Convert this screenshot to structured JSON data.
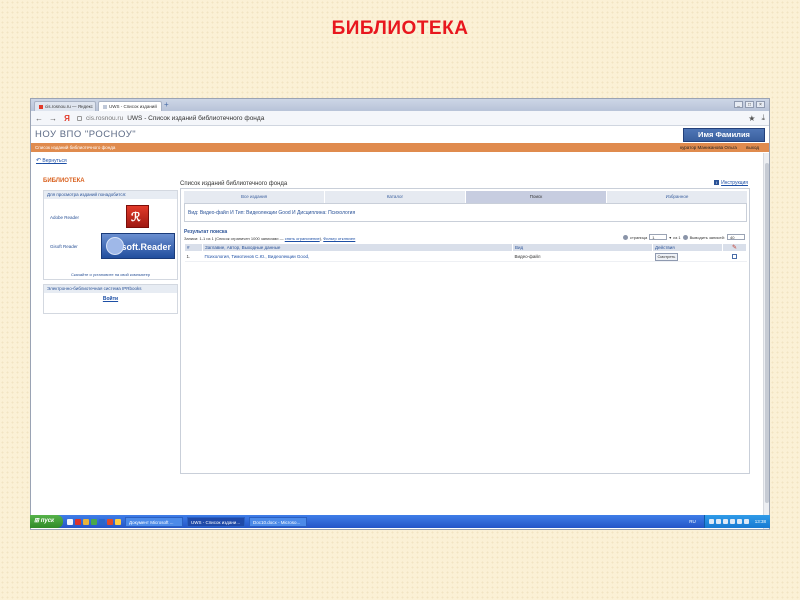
{
  "slide": {
    "title": "БИБЛИОТЕКА"
  },
  "browser": {
    "tabs": [
      {
        "label": "cis.rosnou.ru — Яндекс",
        "active": false
      },
      {
        "label": "UWS - Список изданий",
        "active": true
      }
    ],
    "url_domain": "cis.rosnou.ru",
    "url_title": "UWS - Список изданий библиотечного фонда"
  },
  "header": {
    "logo": "НОУ ВПО \"РОСНОУ\"",
    "user_name": "Имя Фамилия",
    "breadcrumb": "Список изданий библиотечного фонда",
    "user_role": "куратор Маниканова Ольга",
    "logout": "выход"
  },
  "back_link": "Вернуться",
  "sidebar": {
    "heading": "БИБЛИОТЕКА",
    "readers_panel": {
      "title": "Для просмотра изданий понадобится:",
      "adobe_label": "Adobe Reader",
      "gisoft_label": "Gisoft Reader",
      "gisoft_logo_text": "Gisoft.Reader",
      "download_note": "Скачайте и установите на свой компьютер"
    },
    "ebs_panel": {
      "title": "Электронно-библиотечная система IPRbooks",
      "login": "Войти"
    }
  },
  "main": {
    "title": "Список изданий библиотечного фонда",
    "instruction": "Инструкция",
    "tabs": [
      {
        "label": "Все издания",
        "active": false
      },
      {
        "label": "Каталог",
        "active": false
      },
      {
        "label": "Поиск",
        "active": true
      },
      {
        "label": "Избранное",
        "active": false
      }
    ],
    "search_criteria": "Вид: Видео-файл И Тип: Видеолекции Good И Дисциплина: Психология",
    "results_title": "Результат поиска",
    "records_prefix": "Записи: 1-1 из 1 (Список ограничен 1000 записями — ",
    "records_link1": "снять ограничение",
    "records_sep": "), ",
    "records_link2": "Фильтр отключен",
    "pager": {
      "page_label": "страница",
      "page_value": "1",
      "of_label": "из 1",
      "per_page_label": "Выводить записей:",
      "per_page_value": "40"
    },
    "table": {
      "columns": [
        "#",
        "Заглавие, Автор, Выходные данные",
        "Вид",
        "Действия"
      ],
      "rows": [
        {
          "num": "1.",
          "title": "Психология, Тимотинов С.Ю., Видеолекции Good,",
          "kind": "Видео-файл",
          "action": "Смотреть"
        }
      ]
    }
  },
  "taskbar": {
    "start": "пуск",
    "tasks": [
      {
        "label": "Документ Microsoft ...",
        "active": false
      },
      {
        "label": "UWS - Список издани...",
        "active": true
      },
      {
        "label": "Doc10.docx - Microso...",
        "active": false
      }
    ],
    "lang": "RU",
    "clock": "13:38"
  }
}
